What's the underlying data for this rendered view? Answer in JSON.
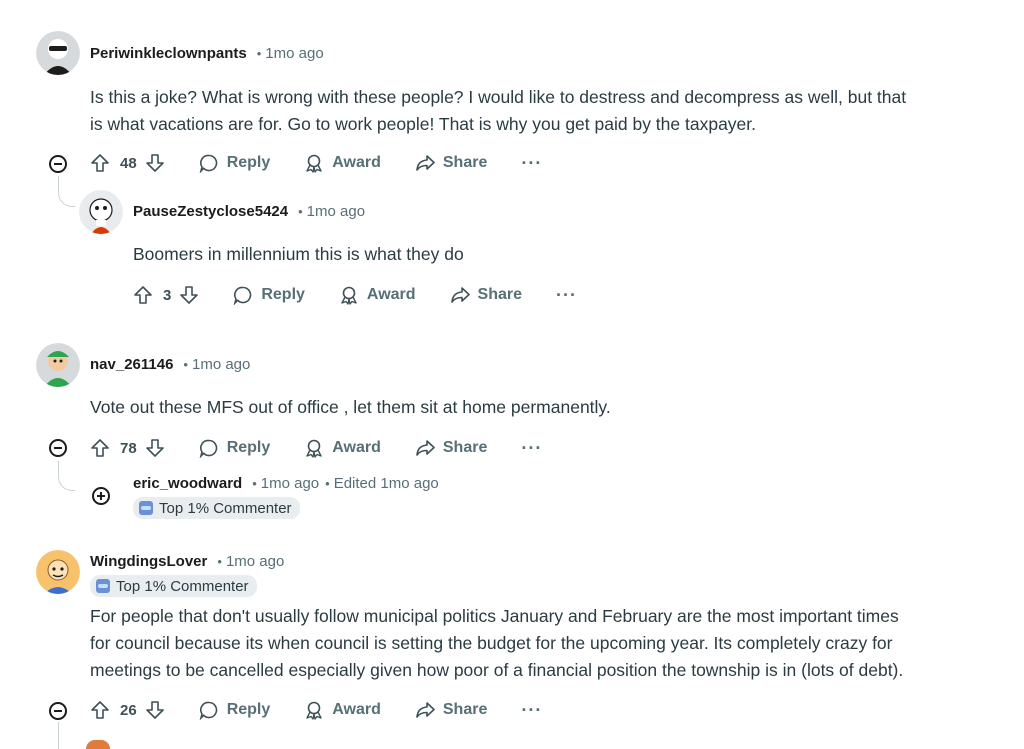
{
  "comments": [
    {
      "author": "Periwinkleclownpants",
      "time": "1mo ago",
      "lines": [
        "Is this a joke? What is wrong with these people? I would like to destress and decompress as well, but that",
        "is what vacations are for. Go to work people! That is why you get paid by the taxpayer."
      ],
      "votes": "48",
      "reply": "Reply",
      "award": "Award",
      "share": "Share",
      "more": "···"
    },
    {
      "author": "PauseZestyclose5424",
      "time": "1mo ago",
      "lines": [
        "Boomers in millennium this is what they do"
      ],
      "votes": "3",
      "reply": "Reply",
      "award": "Award",
      "share": "Share",
      "more": "···"
    },
    {
      "author": "nav_261146",
      "time": "1mo ago",
      "lines": [
        "Vote out these MFS out of office , let them sit at home permanently."
      ],
      "votes": "78",
      "reply": "Reply",
      "award": "Award",
      "share": "Share",
      "more": "···"
    },
    {
      "author": "eric_woodward",
      "time": "1mo ago",
      "edited": "Edited 1mo ago",
      "flair": "Top 1% Commenter"
    },
    {
      "author": "WingdingsLover",
      "time": "1mo ago",
      "flair": "Top 1% Commenter",
      "lines": [
        "For people that don't usually follow municipal politics January and February are the most important times",
        "for council because its when council is setting the budget for the upcoming year. Its completely crazy for",
        "meetings to be cancelled especially given how poor of a financial position the township is in (lots of debt)."
      ],
      "votes": "26",
      "reply": "Reply",
      "award": "Award",
      "share": "Share",
      "more": "···"
    }
  ]
}
